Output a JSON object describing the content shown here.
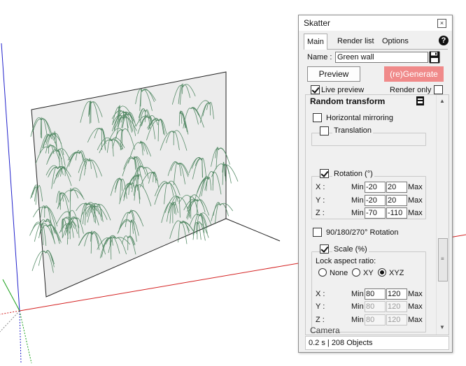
{
  "window": {
    "title": "Skatter",
    "close_glyph": "×"
  },
  "tabs": [
    {
      "label": "Main",
      "active": true
    },
    {
      "label": "Render list",
      "active": false
    },
    {
      "label": "Options",
      "active": false
    }
  ],
  "help_glyph": "?",
  "name_row": {
    "label": "Name :",
    "value": "Green wall"
  },
  "buttons": {
    "preview": "Preview",
    "regenerate": "(re)Generate"
  },
  "checks": {
    "live_preview": {
      "label": "Live preview",
      "checked": true
    },
    "render_only": {
      "label": "Render only",
      "checked": false
    }
  },
  "random_transform": {
    "header": "Random transform",
    "horizontal_mirroring": {
      "label": "Horizontal mirroring",
      "checked": false
    },
    "translation": {
      "label": "Translation",
      "checked": false
    },
    "rotation": {
      "label": "Rotation (°)",
      "checked": true,
      "rows": [
        {
          "axis": "X :",
          "min_label": "Min",
          "min": "-20",
          "max": "20",
          "max_label": "Max"
        },
        {
          "axis": "Y :",
          "min_label": "Min",
          "min": "-20",
          "max": "20",
          "max_label": "Max"
        },
        {
          "axis": "Z :",
          "min_label": "Min",
          "min": "-70",
          "max": "-110",
          "max_label": "Max"
        }
      ]
    },
    "rotation_90": {
      "label": "90/180/270° Rotation",
      "checked": false
    },
    "scale": {
      "label": "Scale (%)",
      "checked": true,
      "lock_label": "Lock aspect ratio:",
      "options": [
        "None",
        "XY",
        "XYZ"
      ],
      "selected": "XYZ",
      "rows": [
        {
          "axis": "X :",
          "min_label": "Min",
          "min": "80",
          "max": "120",
          "max_label": "Max",
          "disabled": false
        },
        {
          "axis": "Y :",
          "min_label": "Min",
          "min": "80",
          "max": "120",
          "max_label": "Max",
          "disabled": true
        },
        {
          "axis": "Z :",
          "min_label": "Min",
          "min": "80",
          "max": "120",
          "max_label": "Max",
          "disabled": true
        }
      ]
    }
  },
  "next_section": "Camera",
  "status": "0.2 s | 208 Objects",
  "colors": {
    "regenerate_bg": "#f08a8a",
    "axis_red": "#d42020",
    "axis_green": "#1aa01a",
    "axis_blue": "#2222cc",
    "foliage": "#3c7a50"
  }
}
